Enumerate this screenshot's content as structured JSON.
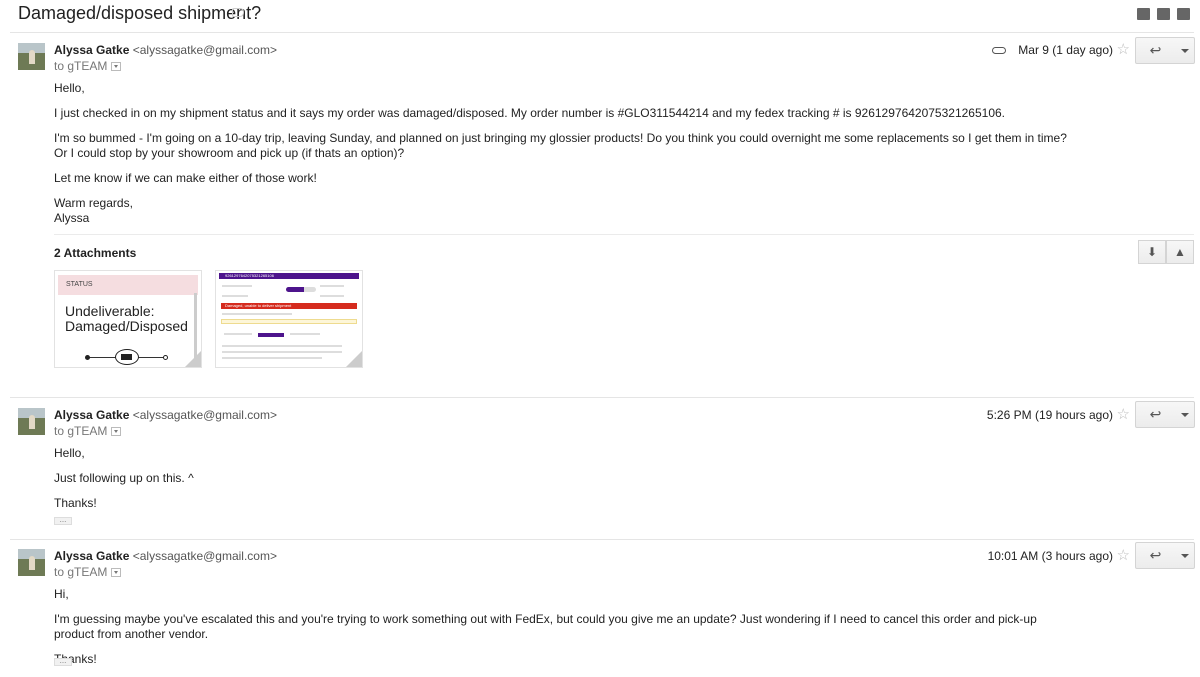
{
  "subject": "Damaged/disposed shipment?",
  "messages": [
    {
      "sender_name": "Alyssa Gatke",
      "sender_email": "<alyssagatke@gmail.com>",
      "to": "to gTEAM",
      "date": "Mar 9 (1 day ago)",
      "has_attachment_icon": true,
      "body": [
        "Hello,",
        "I just checked in on my shipment status and it says my order was damaged/disposed. My order number is #GLO311544214 and my fedex tracking # is 9261297642075321265106.",
        "I'm so bummed - I'm going on a 10-day trip, leaving Sunday, and planned on just bringing my glossier products! Do you think you could overnight me some replacements so I get them in time? Or I could stop by your showroom and pick up (if thats an option)?",
        "Let me know if we can make either of those work!",
        "Warm regards,",
        "Alyssa"
      ]
    },
    {
      "sender_name": "Alyssa Gatke",
      "sender_email": "<alyssagatke@gmail.com>",
      "to": "to gTEAM",
      "date": "5:26 PM (19 hours ago)",
      "body": [
        "Hello,",
        "Just following up on this. ^",
        "Thanks!"
      ]
    },
    {
      "sender_name": "Alyssa Gatke",
      "sender_email": "<alyssagatke@gmail.com>",
      "to": "to gTEAM",
      "date": "10:01 AM (3 hours ago)",
      "body": [
        "Hi,",
        "I'm guessing maybe you've escalated this and you're trying to work something out with FedEx, but could you give me an update? Just wondering if I need to cancel this order and pick-up product from another vendor.",
        "Thanks!"
      ]
    }
  ],
  "attachments": {
    "title": "2 Attachments",
    "thumb1_status": "STATUS",
    "thumb1_line1": "Undeliverable:",
    "thumb1_line2": "Damaged/Disposed",
    "thumb2_tracking": "9261297642075321265106",
    "thumb2_alert": "Damaged, unable to deliver shipment"
  },
  "quoted_marker": "...",
  "icons": [
    "archive-icon",
    "print-icon",
    "new-window-icon",
    "reply-icon",
    "star-icon",
    "paperclip-icon",
    "download-icon",
    "drive-icon",
    "label-icon",
    "dropdown-icon"
  ]
}
